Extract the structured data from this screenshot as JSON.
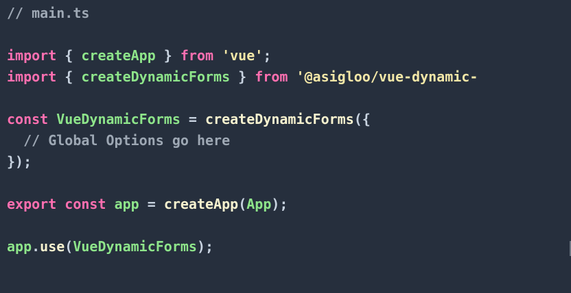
{
  "editor": {
    "lines": [
      [
        {
          "t": "// main.ts",
          "c": "comment"
        }
      ],
      [],
      [
        {
          "t": "import",
          "c": "keyword"
        },
        {
          "t": " { ",
          "c": "punct"
        },
        {
          "t": "createApp",
          "c": "var"
        },
        {
          "t": " } ",
          "c": "punct"
        },
        {
          "t": "from",
          "c": "keyword"
        },
        {
          "t": " ",
          "c": "punct"
        },
        {
          "t": "'vue'",
          "c": "string"
        },
        {
          "t": ";",
          "c": "punct"
        }
      ],
      [
        {
          "t": "import",
          "c": "keyword"
        },
        {
          "t": " { ",
          "c": "punct"
        },
        {
          "t": "createDynamicForms",
          "c": "var"
        },
        {
          "t": " } ",
          "c": "punct"
        },
        {
          "t": "from",
          "c": "keyword"
        },
        {
          "t": " ",
          "c": "punct"
        },
        {
          "t": "'@asigloo/vue-dynamic-",
          "c": "string"
        }
      ],
      [],
      [
        {
          "t": "const",
          "c": "keyword"
        },
        {
          "t": " ",
          "c": "punct"
        },
        {
          "t": "VueDynamicForms",
          "c": "var"
        },
        {
          "t": " = ",
          "c": "punct"
        },
        {
          "t": "createDynamicForms",
          "c": "func"
        },
        {
          "t": "({",
          "c": "punct"
        }
      ],
      [
        {
          "t": "  // Global Options go here",
          "c": "comment"
        }
      ],
      [
        {
          "t": "});",
          "c": "punct"
        }
      ],
      [],
      [
        {
          "t": "export",
          "c": "keyword"
        },
        {
          "t": " ",
          "c": "punct"
        },
        {
          "t": "const",
          "c": "keyword"
        },
        {
          "t": " ",
          "c": "punct"
        },
        {
          "t": "app",
          "c": "var"
        },
        {
          "t": " = ",
          "c": "punct"
        },
        {
          "t": "createApp",
          "c": "func"
        },
        {
          "t": "(",
          "c": "punct"
        },
        {
          "t": "App",
          "c": "var"
        },
        {
          "t": ");",
          "c": "punct"
        }
      ],
      [],
      [
        {
          "t": "app",
          "c": "var"
        },
        {
          "t": ".",
          "c": "punct"
        },
        {
          "t": "use",
          "c": "func"
        },
        {
          "t": "(",
          "c": "punct"
        },
        {
          "t": "VueDynamicForms",
          "c": "var"
        },
        {
          "t": ");",
          "c": "punct"
        }
      ]
    ]
  },
  "colors": {
    "background": "#262f3d",
    "comment": "#9ea8b4",
    "keyword": "#ff6fb0",
    "variable": "#8ee58a",
    "punctuation": "#c8d3e0",
    "string": "#f3e7a7",
    "function": "#f7f2cf"
  }
}
